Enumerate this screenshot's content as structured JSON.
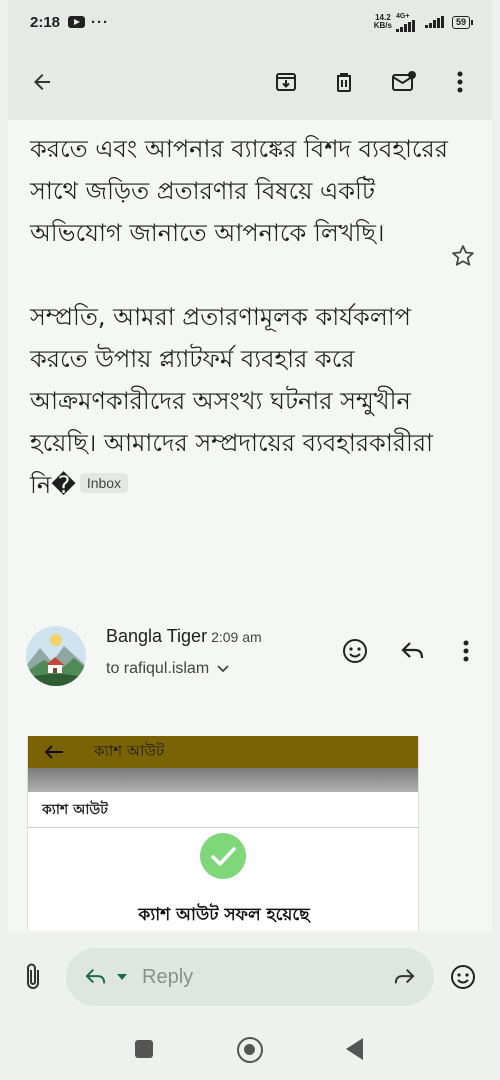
{
  "status_bar": {
    "time": "2:18",
    "more": "···",
    "net_speed_value": "14.2",
    "net_speed_unit": "KB/s",
    "network": "4G+",
    "battery": "59"
  },
  "toolbar": {
    "icons": [
      "back-arrow-icon",
      "archive-icon",
      "delete-icon",
      "mark-unread-icon",
      "more-vertical-icon"
    ]
  },
  "message": {
    "paragraph1": "করতে এবং আপনার ব্যাঙ্কের বিশদ ব্যবহারের সাথে জড়িত প্রতারণার বিষয়ে একটি অভিযোগ জানাতে আপনাকে লিখছি।",
    "paragraph2": "সম্প্রতি, আমরা প্রতারণামূলক কার্যকলাপ করতে উপায় প্ল্যাটফর্ম ব্যবহার করে আক্রমণকারীদের অসংখ্য ঘটনার সম্মুখীন হয়েছি। আমাদের সম্প্রদায়ের ব্যবহারকারীরা নি�",
    "label": "Inbox"
  },
  "sender": {
    "name": "Bangla Tiger",
    "time": "2:09 am",
    "to": "to rafiqul.islam"
  },
  "attachment": {
    "bar_title": "ক্যাশ আউট",
    "header": "ক্যাশ আউট",
    "success_text": "ক্যাশ আউট সফল হয়েছে"
  },
  "reply_bar": {
    "reply_label": "Reply"
  },
  "colors": {
    "accent": "#1a6b52",
    "success_green": "#7ed87a",
    "embed_bar": "#7a6306"
  }
}
